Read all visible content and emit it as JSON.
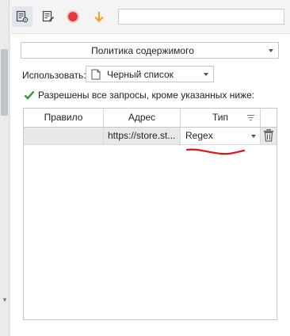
{
  "toolbar": {
    "search_value": ""
  },
  "section": {
    "title": "Политика содержимого"
  },
  "use": {
    "label": "Использовать:",
    "value": "Черный список"
  },
  "note": "Разрешены все запросы, кроме указанных ниже:",
  "grid": {
    "columns": [
      "Правило",
      "Адрес",
      "Тип"
    ],
    "rows": [
      {
        "rule": "",
        "address": "https://store.st...",
        "type": "Regex"
      }
    ]
  },
  "colors": {
    "accent_check": "#2a9a3c",
    "record": "#e23b3b",
    "arrow": "#f0a025",
    "annotation": "#e0141a"
  }
}
